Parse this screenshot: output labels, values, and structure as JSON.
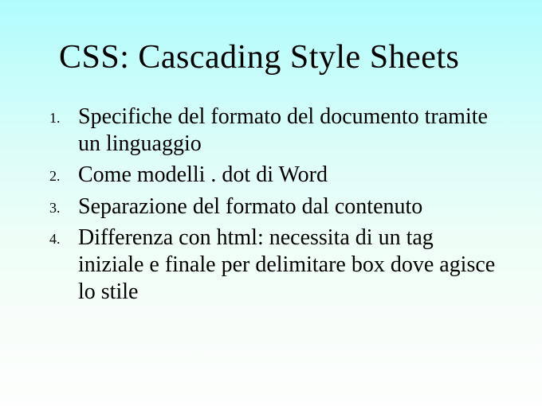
{
  "title": "CSS: Cascading Style Sheets",
  "items": [
    {
      "num": "1.",
      "text": "Specifiche del formato del documento tramite un linguaggio"
    },
    {
      "num": "2.",
      "text": "Come modelli . dot di Word"
    },
    {
      "num": "3.",
      "text": "Separazione del formato dal contenuto"
    },
    {
      "num": "4.",
      "text": "Differenza con html: necessita di un tag iniziale e finale per delimitare box dove agisce lo stile"
    }
  ]
}
